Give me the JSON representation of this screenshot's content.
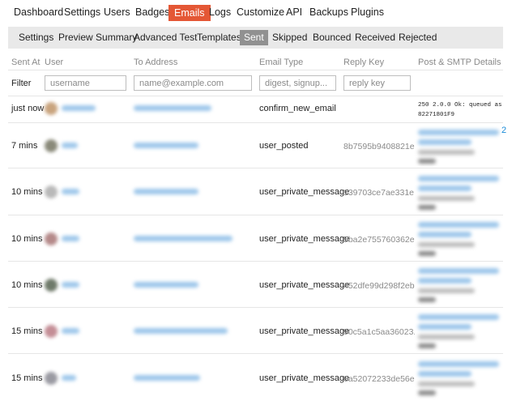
{
  "top_nav": [
    "Dashboard",
    "Settings",
    "Users",
    "Badges",
    "Emails",
    "Logs",
    "Customize",
    "API",
    "Backups",
    "Plugins"
  ],
  "top_nav_active": "Emails",
  "sub_nav": [
    "Settings",
    "Preview Summary",
    "Advanced Test",
    "Templates",
    "Sent",
    "Skipped",
    "Bounced",
    "Received",
    "Rejected"
  ],
  "sub_nav_active": "Sent",
  "columns": [
    "Sent At",
    "User",
    "To Address",
    "Email Type",
    "Reply Key",
    "Post & SMTP Details"
  ],
  "filter": {
    "label": "Filter",
    "username_placeholder": "username",
    "address_placeholder": "name@example.com",
    "type_placeholder": "digest, signup...",
    "reply_key_placeholder": "reply key"
  },
  "rows": [
    {
      "sent_at": "just now",
      "email_type": "confirm_new_email",
      "reply_key": "",
      "smtp_line1": "250 2.0.0 Ok: queued as",
      "smtp_line2": "82271801F9"
    },
    {
      "sent_at": "7 mins",
      "email_type": "user_posted",
      "reply_key": "8b7595b9408821e..."
    },
    {
      "sent_at": "10 mins",
      "email_type": "user_private_message",
      "reply_key": "139703ce7ae331e..."
    },
    {
      "sent_at": "10 mins",
      "email_type": "user_private_message",
      "reply_key": "5ba2e755760362e..."
    },
    {
      "sent_at": "10 mins",
      "email_type": "user_private_message",
      "reply_key": "452dfe99d298f2eb..."
    },
    {
      "sent_at": "15 mins",
      "email_type": "user_private_message",
      "reply_key": "90c5a1c5aa36023..."
    },
    {
      "sent_at": "15 mins",
      "email_type": "user_private_message",
      "reply_key": "6a52072233de56e..."
    }
  ],
  "edge_number": "2",
  "colors": {
    "accent": "#e45735",
    "subnav_bg": "#e9e9e9",
    "subnav_active": "#919191",
    "link_blur": "#9cc6ea"
  }
}
